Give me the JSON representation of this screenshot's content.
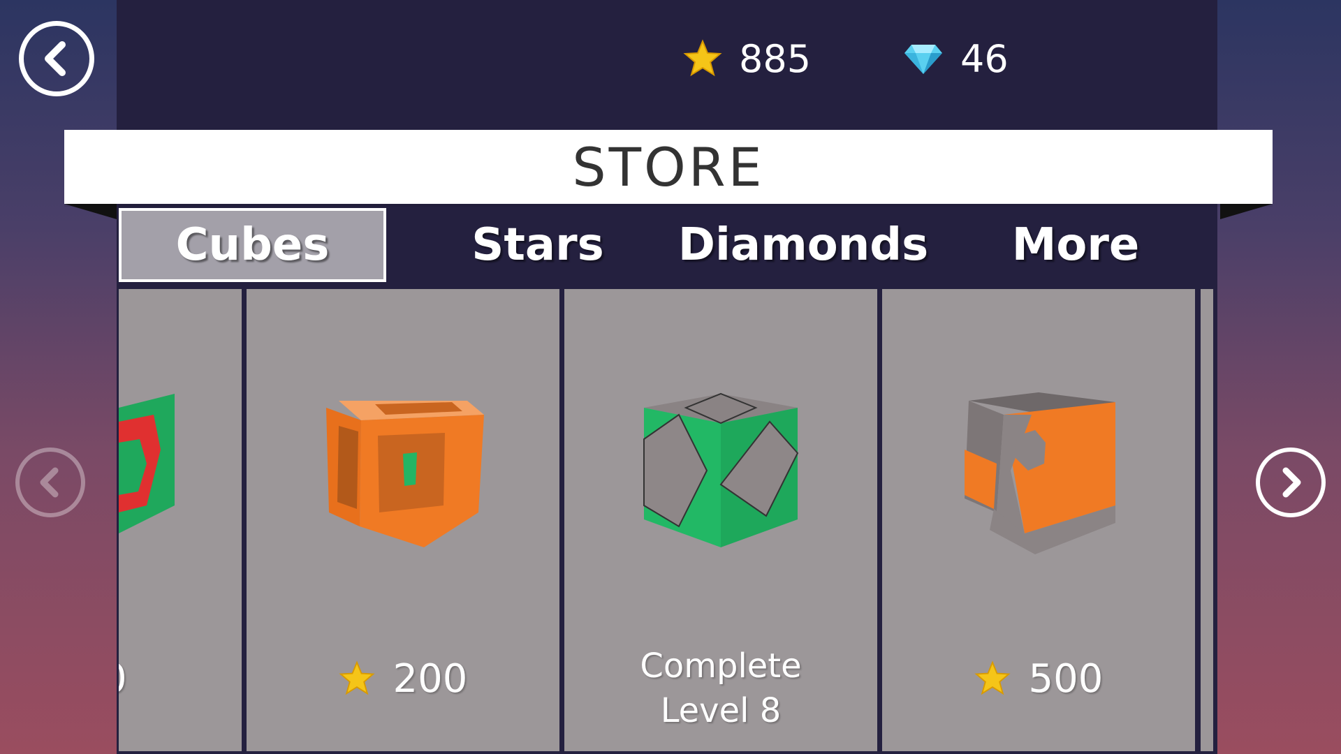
{
  "header": {
    "stars_value": "885",
    "diamonds_value": "46"
  },
  "store": {
    "title": "STORE"
  },
  "tabs": [
    {
      "label": "Cubes",
      "active": true
    },
    {
      "label": "Stars",
      "active": false
    },
    {
      "label": "Diamonds",
      "active": false
    },
    {
      "label": "More",
      "active": false
    }
  ],
  "cards": [
    {
      "price_partial": "0"
    },
    {
      "price": "200",
      "currency_icon": "star-icon"
    },
    {
      "requirement_line1": "Complete",
      "requirement_line2": "Level 8"
    },
    {
      "price": "500",
      "currency_icon": "star-icon"
    }
  ],
  "icons": {
    "back": "chevron-left-icon",
    "prev": "chevron-left-icon",
    "next": "chevron-right-icon",
    "star": "star-icon",
    "diamond": "diamond-icon"
  },
  "colors": {
    "panel": "#24203f",
    "card": "#9c9799",
    "orange": "#f07a24",
    "green": "#22b865",
    "gray_face": "#8e8788"
  }
}
